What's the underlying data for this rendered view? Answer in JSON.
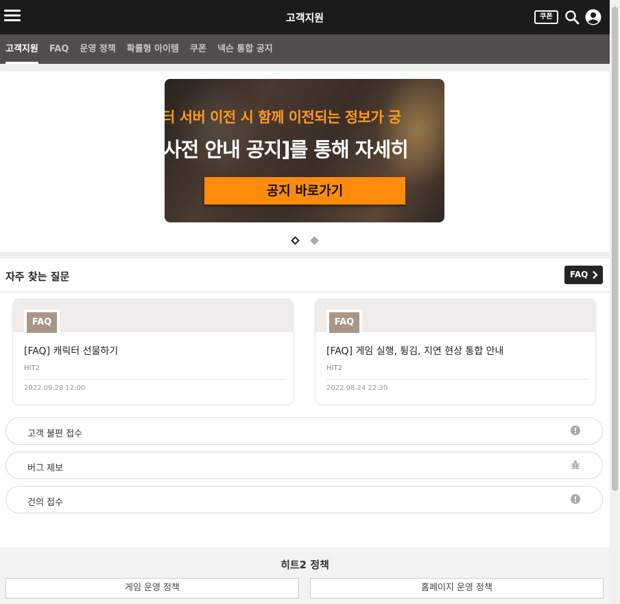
{
  "header": {
    "title": "고객지원",
    "coupon_label": "쿠폰",
    "icons": [
      "menu-icon",
      "coupon-icon",
      "search-icon",
      "account-icon"
    ]
  },
  "tabs": [
    {
      "label": "고객지원",
      "active": true
    },
    {
      "label": "FAQ",
      "active": false
    },
    {
      "label": "운영 정책",
      "active": false
    },
    {
      "label": "확률형 아이템",
      "active": false
    },
    {
      "label": "쿠폰",
      "active": false
    },
    {
      "label": "넥슨 통합 공지",
      "active": false
    }
  ],
  "banner": {
    "line1": "터 서버 이전 시 함께 이전되는 정보가 궁",
    "line2": "사전 안내 공지]를 통해 자세히",
    "cta": "공지 바로가기",
    "slides": 2,
    "active_slide": 1
  },
  "faq_section": {
    "title": "자주 찾는 질문",
    "more_label": "FAQ",
    "cards": [
      {
        "badge": "FAQ",
        "title": "[FAQ] 캐릭터 선물하기",
        "game": "HIT2",
        "date": "2022.09.28 12:00"
      },
      {
        "badge": "FAQ",
        "title": "[FAQ] 게임 실행, 튕김, 지연 현상 통합 안내",
        "game": "HIT2",
        "date": "2022.08.24 22:30"
      }
    ]
  },
  "actions": [
    {
      "label": "고객 불편 접수",
      "icon": "alert-icon"
    },
    {
      "label": "버그 제보",
      "icon": "bug-icon"
    },
    {
      "label": "건의 접수",
      "icon": "alert-icon"
    }
  ],
  "policy": {
    "title": "히트2 정책",
    "buttons": [
      "게임 운영 정책",
      "홈페이지 운영 정책"
    ]
  },
  "colors": {
    "topbar": "#1b1b1b",
    "subnav": "#524d4b",
    "accent_orange": "#ff8b0c",
    "faq_badge": "#a89688"
  }
}
